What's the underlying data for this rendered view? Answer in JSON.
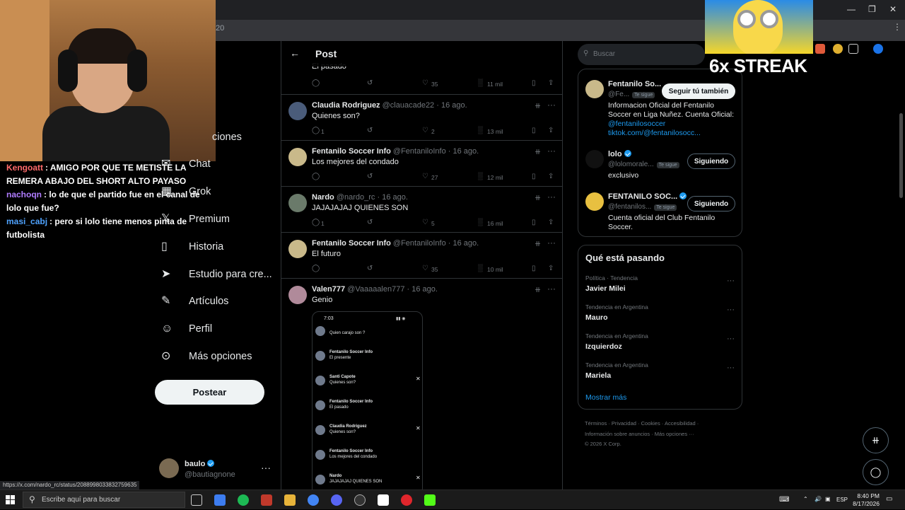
{
  "browser": {
    "url_fragment": "20",
    "status_url": "https://x.com/nardo_rc/status/2088998033832759635"
  },
  "stream": {
    "chat": [
      {
        "user": "Kengoatt",
        "user_color": "#ff6b6b",
        "text": ": AMIGO POR QUE TE METISTE LA REMERA ABAJO DEL SHORT ALTO PAYASO"
      },
      {
        "user": "nachoqn",
        "user_color": "#b07cff",
        "text": ": lo de que el partido fue en el canal de lolo que fue?"
      },
      {
        "user": "masi_cabj",
        "user_color": "#4fa3ff",
        "text": ": pero si lolo tiene menos pinta de futbolista"
      }
    ],
    "overlay_text": "6x STREAK"
  },
  "nav": {
    "partial_items": [
      {
        "label": "ciones"
      }
    ],
    "items": [
      {
        "label": "Chat",
        "icon": "chat-icon"
      },
      {
        "label": "Grok",
        "icon": "grok-icon"
      },
      {
        "label": "Premium",
        "icon": "x-premium-icon"
      },
      {
        "label": "Historia",
        "icon": "bookmark-icon"
      },
      {
        "label": "Estudio para cre...",
        "icon": "rocket-icon"
      },
      {
        "label": "Artículos",
        "icon": "article-icon"
      },
      {
        "label": "Perfil",
        "icon": "person-icon"
      },
      {
        "label": "Más opciones",
        "icon": "more-circle-icon"
      }
    ],
    "post_button": "Postear",
    "account": {
      "name": "baulo",
      "handle": "@bautiagnone"
    }
  },
  "feed": {
    "title": "Post",
    "tweets": [
      {
        "name": "",
        "handle": "",
        "date": "",
        "text": "El pasado",
        "replies": "",
        "retweets": "",
        "likes": "35",
        "views": "11 mil",
        "avatar_color": "#5a6f8a"
      },
      {
        "name": "Claudia Rodriguez",
        "handle": "@clauacade22",
        "date": "· 16 ago.",
        "text": "Quienes son?",
        "replies": "1",
        "retweets": "",
        "likes": "2",
        "views": "13 mil",
        "avatar_color": "#4a5c7a"
      },
      {
        "name": "Fentanilo Soccer Info",
        "handle": "@FentaniloInfo",
        "date": "· 16 ago.",
        "text": "Los mejores del condado",
        "replies": "",
        "retweets": "",
        "likes": "27",
        "views": "12 mil",
        "avatar_color": "#c9b98a"
      },
      {
        "name": "Nardo",
        "handle": "@nardo_rc",
        "date": "· 16 ago.",
        "text": "JAJAJAJAJ QUIENES SON",
        "replies": "1",
        "retweets": "",
        "likes": "5",
        "views": "16 mil",
        "avatar_color": "#6a7a6a"
      },
      {
        "name": "Fentanilo Soccer Info",
        "handle": "@FentaniloInfo",
        "date": "· 16 ago.",
        "text": "El futuro",
        "replies": "",
        "retweets": "",
        "likes": "35",
        "views": "10 mil",
        "avatar_color": "#c9b98a"
      },
      {
        "name": "Valen777",
        "handle": "@Vaaaaalen777",
        "date": "· 16 ago.",
        "text": "Genio",
        "replies": "",
        "retweets": "",
        "likes": "",
        "views": "",
        "avatar_color": "#b08a9a"
      }
    ],
    "embed": {
      "time": "7:03",
      "rows": [
        {
          "name": "",
          "text": "Quien carajo son ?"
        },
        {
          "name": "Fentanilo Soccer Info",
          "text": "El presente"
        },
        {
          "name": "Santi Capote",
          "text": "Quienes son?"
        },
        {
          "name": "Fentanilo Soccer Info",
          "text": "El pasado"
        },
        {
          "name": "Claudia Rodriguez",
          "text": "Quienes son?"
        },
        {
          "name": "Fentanilo Soccer Info",
          "text": "Los mejores del condado"
        },
        {
          "name": "Nardo",
          "text": "JAJAJAJAJ QUIENES SON"
        }
      ]
    }
  },
  "sidebar": {
    "search_placeholder": "Buscar",
    "related": [
      {
        "name": "Fentanilo So...",
        "handle": "@Fe...",
        "badge": "Te sigue",
        "button": "Seguir tú también",
        "bio": "Informacion Oficial del Fentanilo Soccer en Liga Nuñez. Cuenta Oficial:",
        "links": [
          "@fentanilosoccer",
          "tiktok.com/@fentanilosocc..."
        ],
        "avatar_color": "#c9b98a",
        "verified": false
      },
      {
        "name": "lolo",
        "handle": "@lolomorale...",
        "badge": "Te sigue",
        "button": "Siguiendo",
        "bio": "exclusivo",
        "links": [],
        "avatar_color": "#111111",
        "verified": true
      },
      {
        "name": "FENTANILO SOC...",
        "handle": "@fentanilos...",
        "badge": "Te sigue",
        "button": "Siguiendo",
        "bio": "Cuenta oficial del Club Fentanilo Soccer.",
        "links": [],
        "avatar_color": "#e8c040",
        "verified": true
      }
    ],
    "trends_title": "Qué está pasando",
    "trends": [
      {
        "context": "Política · Tendencia",
        "name": "Javier Milei"
      },
      {
        "context": "Tendencia en Argentina",
        "name": "Mauro"
      },
      {
        "context": "Tendencia en Argentina",
        "name": "Izquierdoz"
      },
      {
        "context": "Tendencia en Argentina",
        "name": "Mariela"
      }
    ],
    "show_more": "Mostrar más",
    "footer": {
      "line1": "Términos · Privacidad · Cookies · Accesibilidad ·",
      "line2": "Información sobre anuncios · Más opciones ···",
      "line3": "© 2026 X Corp."
    }
  },
  "taskbar": {
    "search_placeholder": "Escribe aquí para buscar",
    "lang": "ESP",
    "time": "8:40 PM",
    "date": "8/17/2026"
  }
}
